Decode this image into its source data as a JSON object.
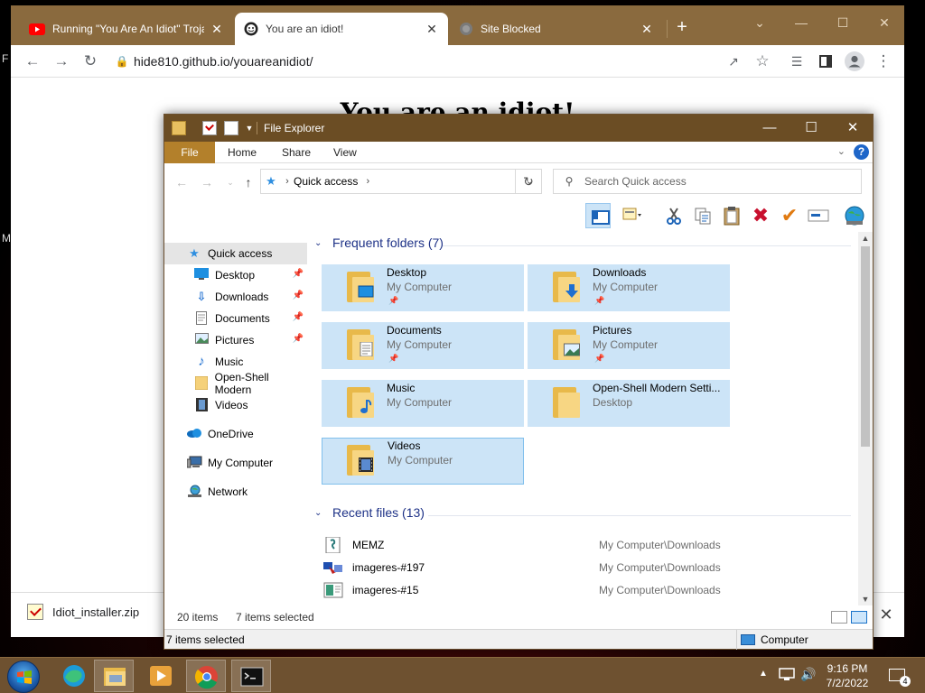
{
  "desktop": {
    "frag_left_top": "F",
    "frag_left_mid": "M"
  },
  "browser": {
    "tabs": [
      {
        "label": "Running \"You Are An Idiot\" Troja",
        "close": "✕"
      },
      {
        "label": "You are an idiot!",
        "close": "✕"
      },
      {
        "label": "Site Blocked",
        "close": "✕"
      }
    ],
    "new_tab": "+",
    "url": "hide810.github.io/youareanidiot/",
    "page_title": "You are an idiot!",
    "download": {
      "filename": "Idiot_installer.zip",
      "close": "✕"
    }
  },
  "explorer": {
    "title": "File Explorer",
    "ribbon_tabs": [
      "File",
      "Home",
      "Share",
      "View"
    ],
    "help": "?",
    "address": "Quick access",
    "search_placeholder": "Search Quick access",
    "nav": [
      {
        "label": "Quick access",
        "icon": "star-icon",
        "pinned": false
      },
      {
        "label": "Desktop",
        "icon": "desktop-icon",
        "pinned": true
      },
      {
        "label": "Downloads",
        "icon": "download-arrow-icon",
        "pinned": true
      },
      {
        "label": "Documents",
        "icon": "document-icon",
        "pinned": true
      },
      {
        "label": "Pictures",
        "icon": "pictures-icon",
        "pinned": true
      },
      {
        "label": "Music",
        "icon": "music-note-icon",
        "pinned": false
      },
      {
        "label": "Open-Shell Modern",
        "icon": "folder-icon",
        "pinned": false
      },
      {
        "label": "Videos",
        "icon": "film-icon",
        "pinned": false
      },
      {
        "label": "OneDrive",
        "icon": "cloud-icon",
        "pinned": false
      },
      {
        "label": "My Computer",
        "icon": "computer-icon",
        "pinned": false
      },
      {
        "label": "Network",
        "icon": "network-icon",
        "pinned": false
      }
    ],
    "frequent_header": "Frequent folders (7)",
    "frequent": [
      {
        "name": "Desktop",
        "location": "My Computer",
        "pinned": true,
        "overlay": "desktop-icon"
      },
      {
        "name": "Downloads",
        "location": "My Computer",
        "pinned": true,
        "overlay": "download-arrow-icon"
      },
      {
        "name": "Documents",
        "location": "My Computer",
        "pinned": true,
        "overlay": "document-icon"
      },
      {
        "name": "Pictures",
        "location": "My Computer",
        "pinned": true,
        "overlay": "pictures-icon"
      },
      {
        "name": "Music",
        "location": "My Computer",
        "pinned": false,
        "overlay": "music-note-icon"
      },
      {
        "name": "Open-Shell Modern Setti...",
        "location": "Desktop",
        "pinned": false,
        "overlay": ""
      },
      {
        "name": "Videos",
        "location": "My Computer",
        "pinned": false,
        "overlay": "film-icon"
      }
    ],
    "recent_header": "Recent files (13)",
    "recent": [
      {
        "name": "MEMZ",
        "path": "My Computer\\Downloads"
      },
      {
        "name": "imageres-#197",
        "path": "My Computer\\Downloads"
      },
      {
        "name": "imageres-#15",
        "path": "My Computer\\Downloads"
      }
    ],
    "status_items": "20 items",
    "status_selected": "7 items selected",
    "classic_status_left": "7 items selected",
    "classic_status_right": "Computer"
  },
  "taskbar": {
    "time": "9:16 PM",
    "date": "7/2/2022",
    "notification_count": "4"
  },
  "colors": {
    "title_accent": "#6b4d24",
    "tile_selected": "#cce4f7",
    "group_header": "#1e3287",
    "file_tab": "#b3802b"
  }
}
